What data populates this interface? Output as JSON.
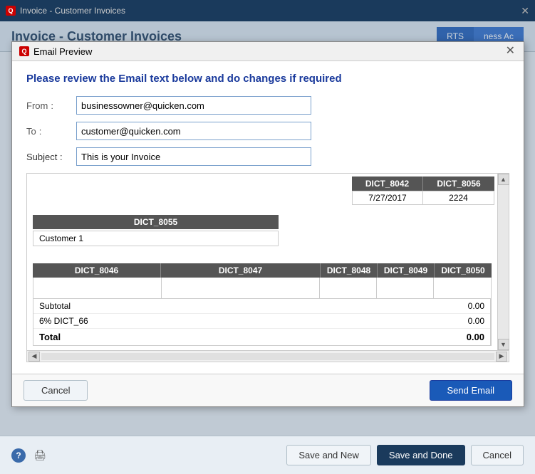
{
  "bg_window": {
    "titlebar": {
      "icon": "Q",
      "title": "Invoice - Customer Invoices",
      "close": "✕"
    },
    "header": "Invoice - Customer Invoices",
    "tabs": {
      "right1": "RTS",
      "right2": "ness Ac"
    }
  },
  "modal": {
    "title": "Email Preview",
    "icon": "Q",
    "close": "✕",
    "heading": "Please review the Email text below and do changes if required",
    "form": {
      "from_label": "From",
      "from_colon": ":",
      "from_value": "businessowner@quicken.com",
      "to_label": "To",
      "to_colon": ":",
      "to_value": "customer@quicken.com",
      "subject_label": "Subject :",
      "subject_value": "This is your Invoice"
    },
    "invoice": {
      "top_headers": [
        "DICT_8042",
        "DICT_8056"
      ],
      "top_values": [
        "7/27/2017",
        "2224"
      ],
      "customer_header": "DICT_8055",
      "customer_value": "Customer 1",
      "line_headers": [
        "DICT_8046",
        "DICT_8047",
        "DICT_8048",
        "DICT_8049",
        "DICT_8050"
      ],
      "subtotal_label": "Subtotal",
      "subtotal_value": "0.00",
      "tax_label": "6% DICT_66",
      "tax_value": "0.00",
      "total_label": "Total",
      "total_value": "0.00"
    },
    "footer": {
      "cancel_label": "Cancel",
      "send_label": "Send Email"
    }
  },
  "bottom_bar": {
    "help_icon": "?",
    "print_icon": "🖨",
    "save_new_label": "Save and New",
    "save_done_label": "Save and Done",
    "cancel_label": "Cancel"
  }
}
